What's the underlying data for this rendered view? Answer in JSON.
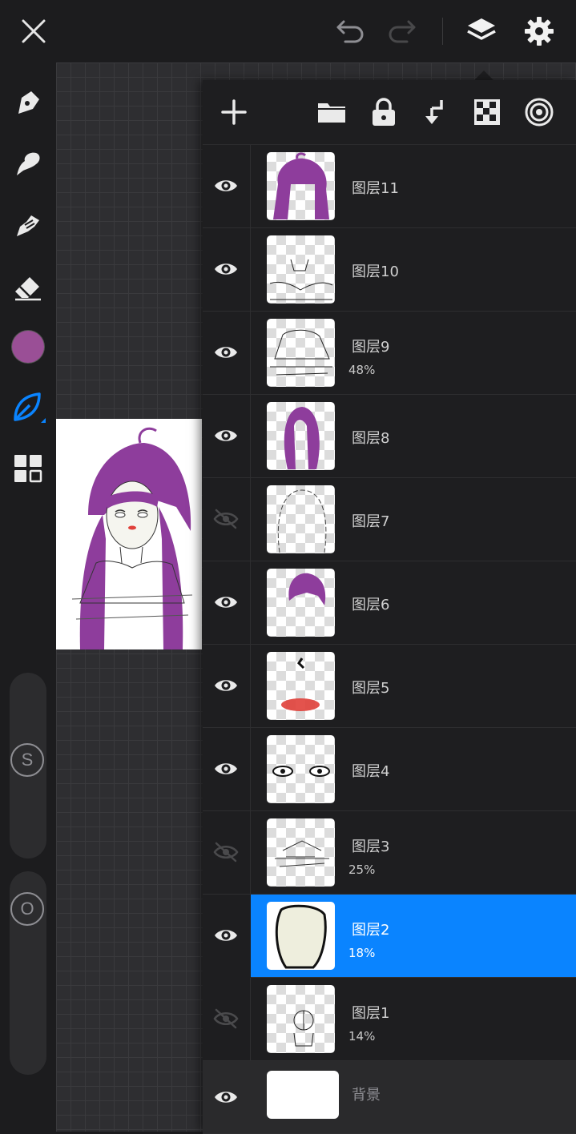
{
  "colors": {
    "accent": "#0a84ff",
    "brush_color": "#9a4f96",
    "hair": "#8e3d9c"
  },
  "topbar": {
    "close_icon": "close-icon",
    "undo_icon": "undo-icon",
    "redo_icon": "redo-icon",
    "layers_icon": "layers-icon",
    "settings_icon": "gear-icon"
  },
  "left_tools": {
    "items": [
      "pen-icon",
      "smudge-icon",
      "blur-icon",
      "eraser-icon",
      "color-swatch",
      "leaf-brush-icon",
      "grid-menu-icon"
    ],
    "size_slider_label": "S",
    "opacity_slider_label": "O"
  },
  "layers_panel": {
    "toolbar": [
      "add-layer-icon",
      "folder-icon",
      "lock-icon",
      "merge-down-icon",
      "alpha-lock-icon",
      "clipping-icon"
    ],
    "layers": [
      {
        "name": "图层11",
        "opacity": "",
        "visible": true,
        "selected": false
      },
      {
        "name": "图层10",
        "opacity": "",
        "visible": true,
        "selected": false
      },
      {
        "name": "图层9",
        "opacity": "48%",
        "visible": true,
        "selected": false
      },
      {
        "name": "图层8",
        "opacity": "",
        "visible": true,
        "selected": false
      },
      {
        "name": "图层7",
        "opacity": "",
        "visible": false,
        "selected": false
      },
      {
        "name": "图层6",
        "opacity": "",
        "visible": true,
        "selected": false
      },
      {
        "name": "图层5",
        "opacity": "",
        "visible": true,
        "selected": false
      },
      {
        "name": "图层4",
        "opacity": "",
        "visible": true,
        "selected": false
      },
      {
        "name": "图层3",
        "opacity": "25%",
        "visible": false,
        "selected": false
      },
      {
        "name": "图层2",
        "opacity": "18%",
        "visible": true,
        "selected": true
      },
      {
        "name": "图层1",
        "opacity": "14%",
        "visible": false,
        "selected": false
      }
    ],
    "background": {
      "name": "背景",
      "visible": true
    }
  }
}
